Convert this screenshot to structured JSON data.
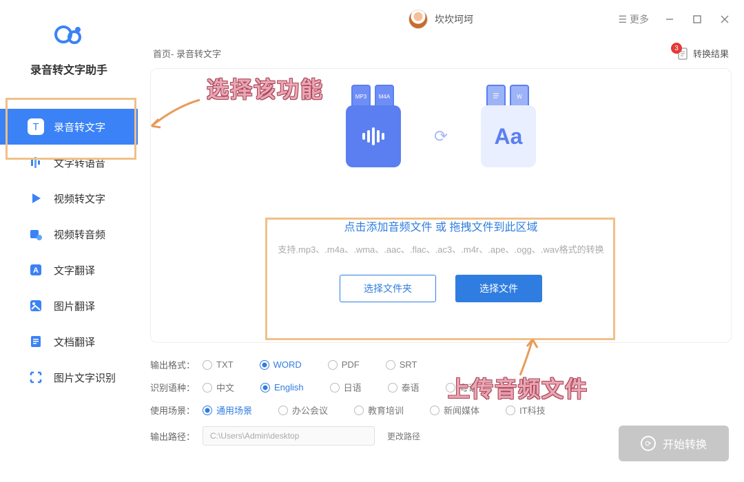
{
  "app": {
    "name": "录音转文字助手"
  },
  "header": {
    "username": "坎坎坷坷",
    "more": "更多"
  },
  "nav": {
    "items": [
      {
        "label": "录音转文字"
      },
      {
        "label": "文字转语音"
      },
      {
        "label": "视频转文字"
      },
      {
        "label": "视频转音频"
      },
      {
        "label": "文字翻译"
      },
      {
        "label": "图片翻译"
      },
      {
        "label": "文档翻译"
      },
      {
        "label": "图片文字识别"
      }
    ]
  },
  "breadcrumb": "首页- 录音转文字",
  "result": {
    "label": "转换结果",
    "badge": "3"
  },
  "drop": {
    "title": "点击添加音频文件 或 拖拽文件到此区域",
    "sub": "支持.mp3、.m4a、.wma、.aac、.flac、.ac3、.m4r、.ape、.ogg、.wav格式的转换",
    "select_folder": "选择文件夹",
    "select_file": "选择文件"
  },
  "illus": {
    "fmt1": "MP3",
    "fmt2": "M4A",
    "aa": "Aa"
  },
  "settings": {
    "output_label": "输出格式：",
    "output": [
      "TXT",
      "WORD",
      "PDF",
      "SRT"
    ],
    "output_selected": 1,
    "lang_label": "识别语种：",
    "lang": [
      "中文",
      "English",
      "日语",
      "泰语",
      "粤语"
    ],
    "lang_selected": 1,
    "scene_label": "使用场景：",
    "scene": [
      "通用场景",
      "办公会议",
      "教育培训",
      "新闻媒体",
      "IT科技"
    ],
    "scene_selected": 0,
    "path_label": "输出路径：",
    "path_value": "C:\\Users\\Admin\\desktop",
    "path_change": "更改路径"
  },
  "start": "开始转换",
  "annotations": {
    "a1": "选择该功能",
    "a2": "上传音频文件"
  }
}
